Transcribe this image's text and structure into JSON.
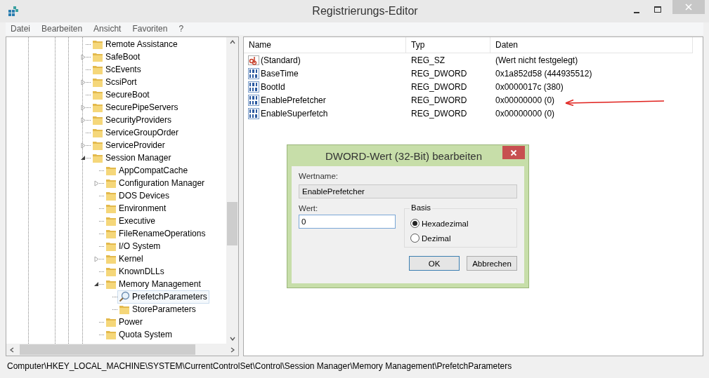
{
  "window": {
    "title": "Registrierungs-Editor"
  },
  "menu": [
    "Datei",
    "Bearbeiten",
    "Ansicht",
    "Favoriten",
    "?"
  ],
  "tree": {
    "items": [
      {
        "label": "Remote Assistance",
        "expandable": false,
        "selected": false
      },
      {
        "label": "SafeBoot",
        "expandable": true,
        "expanded": false,
        "selected": false
      },
      {
        "label": "ScEvents",
        "expandable": false,
        "selected": false
      },
      {
        "label": "ScsiPort",
        "expandable": true,
        "expanded": false,
        "selected": false
      },
      {
        "label": "SecureBoot",
        "expandable": false,
        "selected": false
      },
      {
        "label": "SecurePipeServers",
        "expandable": true,
        "expanded": false,
        "selected": false
      },
      {
        "label": "SecurityProviders",
        "expandable": true,
        "expanded": false,
        "selected": false
      },
      {
        "label": "ServiceGroupOrder",
        "expandable": false,
        "selected": false
      },
      {
        "label": "ServiceProvider",
        "expandable": true,
        "expanded": false,
        "selected": false
      },
      {
        "label": "Session Manager",
        "expandable": true,
        "expanded": true,
        "selected": false,
        "children": [
          {
            "label": "AppCompatCache",
            "expandable": false,
            "selected": false
          },
          {
            "label": "Configuration Manager",
            "expandable": true,
            "expanded": false,
            "selected": false
          },
          {
            "label": "DOS Devices",
            "expandable": false,
            "selected": false
          },
          {
            "label": "Environment",
            "expandable": false,
            "selected": false
          },
          {
            "label": "Executive",
            "expandable": false,
            "selected": false
          },
          {
            "label": "FileRenameOperations",
            "expandable": false,
            "selected": false
          },
          {
            "label": "I/O System",
            "expandable": false,
            "selected": false
          },
          {
            "label": "Kernel",
            "expandable": true,
            "expanded": false,
            "selected": false
          },
          {
            "label": "KnownDLLs",
            "expandable": false,
            "selected": false
          },
          {
            "label": "Memory Management",
            "expandable": true,
            "expanded": true,
            "selected": false,
            "children": [
              {
                "label": "PrefetchParameters",
                "expandable": false,
                "selected": true
              },
              {
                "label": "StoreParameters",
                "expandable": false,
                "selected": false
              }
            ]
          },
          {
            "label": "Power",
            "expandable": false,
            "selected": false
          },
          {
            "label": "Quota System",
            "expandable": false,
            "selected": false
          }
        ]
      }
    ]
  },
  "table": {
    "columns": [
      "Name",
      "Typ",
      "Daten"
    ],
    "rows": [
      {
        "kind": "string",
        "name": "(Standard)",
        "type": "REG_SZ",
        "data": "(Wert nicht festgelegt)"
      },
      {
        "kind": "binary",
        "name": "BaseTime",
        "type": "REG_DWORD",
        "data": "0x1a852d58 (444935512)"
      },
      {
        "kind": "binary",
        "name": "BootId",
        "type": "REG_DWORD",
        "data": "0x0000017c (380)"
      },
      {
        "kind": "binary",
        "name": "EnablePrefetcher",
        "type": "REG_DWORD",
        "data": "0x00000000 (0)"
      },
      {
        "kind": "binary",
        "name": "EnableSuperfetch",
        "type": "REG_DWORD",
        "data": "0x00000000 (0)"
      }
    ]
  },
  "status_bar": "Computer\\HKEY_LOCAL_MACHINE\\SYSTEM\\CurrentControlSet\\Control\\Session Manager\\Memory Management\\PrefetchParameters",
  "dialog": {
    "title": "DWORD-Wert (32-Bit) bearbeiten",
    "name_label": "Wertname:",
    "name_value": "EnablePrefetcher",
    "value_label": "Wert:",
    "value": "0",
    "base_label": "Basis",
    "bases": [
      {
        "label": "Hexadezimal",
        "selected": true
      },
      {
        "label": "Dezimal",
        "selected": false
      }
    ],
    "buttons": [
      "OK",
      "Abbrechen"
    ]
  }
}
